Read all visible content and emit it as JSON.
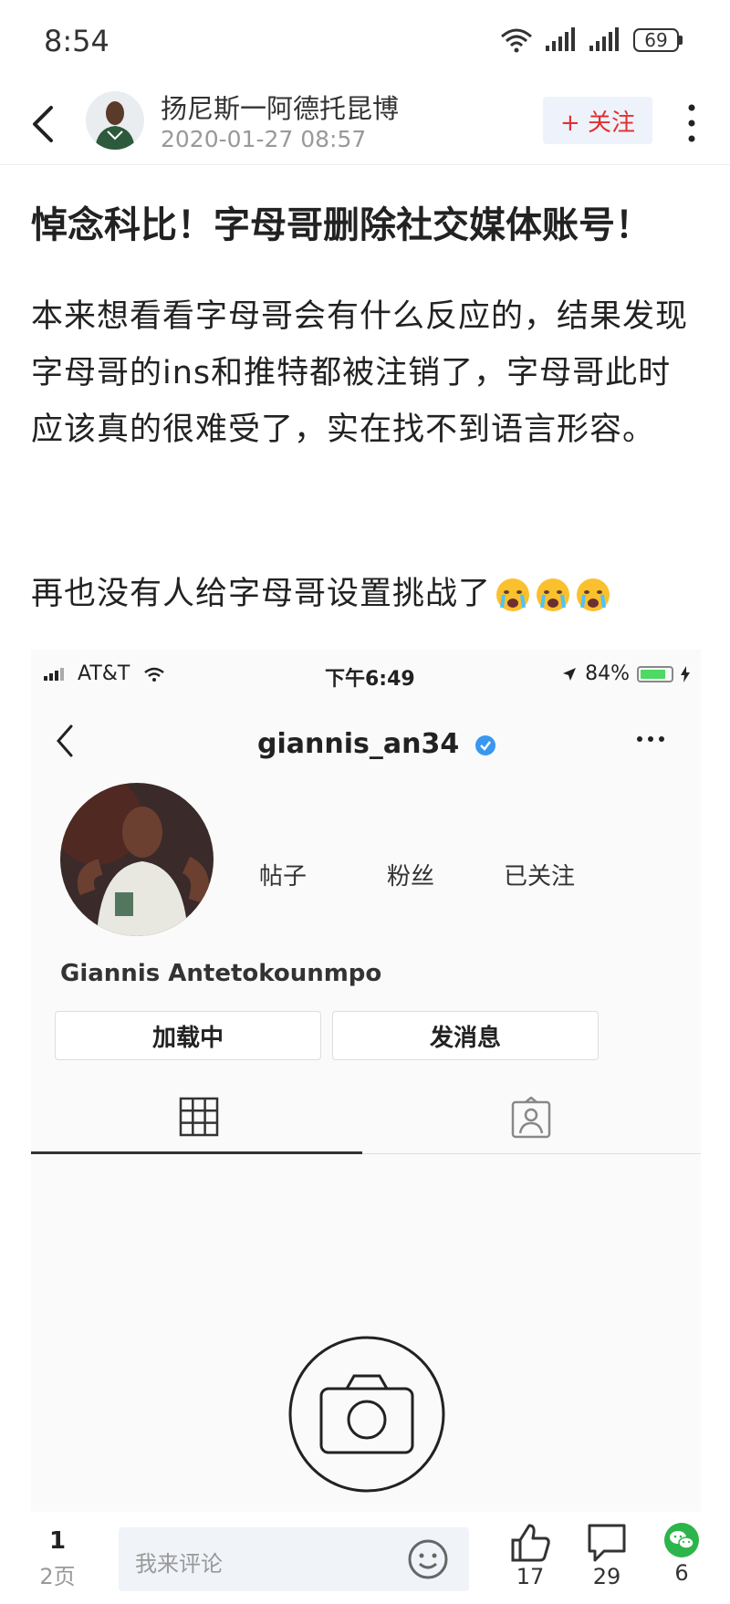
{
  "status_bar": {
    "time": "8:54",
    "battery": "69"
  },
  "header": {
    "author_name": "扬尼斯一阿德托昆博",
    "post_date": "2020-01-27 08:57",
    "follow_label": "+ 关注"
  },
  "article": {
    "title": "悼念科比！字母哥删除社交媒体账号！",
    "paragraph_1": "本来想看看字母哥会有什么反应的，结果发现字母哥的ins和推特都被注销了，字母哥此时应该真的很难受了，实在找不到语言形容。",
    "paragraph_2": "再也没有人给字母哥设置挑战了"
  },
  "screenshot": {
    "carrier": "AT&T",
    "clock": "下午6:49",
    "battery_pct": "84%",
    "username": "giannis_an34",
    "stats": [
      "帖子",
      "粉丝",
      "已关注"
    ],
    "full_name": "Giannis Antetokounmpo",
    "buttons": [
      "加载中",
      "发消息"
    ]
  },
  "bottom_bar": {
    "page_current": "1",
    "page_total": "2页",
    "comment_placeholder": "我来评论",
    "likes": "17",
    "comments": "29",
    "shares": "6"
  },
  "colors": {
    "follow_red": "#e03030",
    "wechat_green": "#2bb54a",
    "verified_blue": "#3897f0"
  }
}
